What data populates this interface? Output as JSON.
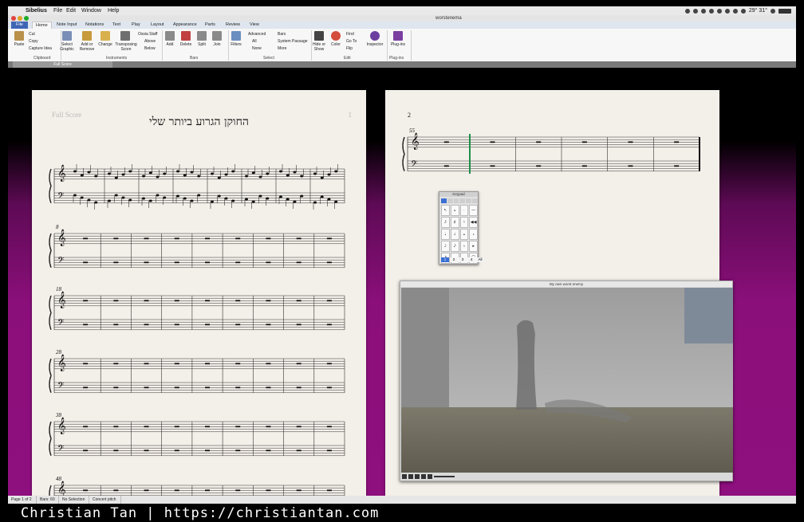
{
  "menubar": {
    "app": "Sibelius",
    "items": [
      "File",
      "Edit",
      "Window",
      "Help"
    ],
    "clock": "29° 31°"
  },
  "window": {
    "doc_title": "worstenema"
  },
  "ribbon": {
    "tabs": [
      "File",
      "Home",
      "Note Input",
      "Notations",
      "Text",
      "Play",
      "Layout",
      "Appearance",
      "Parts",
      "Review",
      "View"
    ],
    "clipboard": {
      "paste": "Paste",
      "cut": "Cut",
      "copy": "Copy",
      "capture": "Capture Idea",
      "label": "Clipboard"
    },
    "instruments": {
      "select_graphic": "Select Graphic",
      "add_remove": "Add or Remove",
      "change": "Change",
      "transposing": "Transposing Score",
      "ossia": "Ossia Staff",
      "above": "Above",
      "below": "Below",
      "label": "Instruments"
    },
    "bars": {
      "add": "Add",
      "delete": "Delete",
      "split": "Split",
      "join": "Join",
      "label": "Bars"
    },
    "select": {
      "filters": "Filters",
      "advanced": "Advanced",
      "all": "All",
      "none": "None",
      "bars": "Bars",
      "system_passage": "System Passage",
      "more": "More",
      "label": "Select"
    },
    "edit": {
      "hide_show": "Hide or Show",
      "color": "Color",
      "find": "Find",
      "goto": "Go To",
      "flip": "Flip",
      "inspector": "Inspector",
      "label": "Edit"
    },
    "plugins": {
      "plugins": "Plug-ins",
      "label": "Plug-ins"
    }
  },
  "viewbar": {
    "tab": "Full Score"
  },
  "page1": {
    "label": "Full Score",
    "page_number": "1",
    "title": "החוקן הגרוע ביותר שלי",
    "system_numbers": [
      "8",
      "18",
      "28",
      "38",
      "48"
    ]
  },
  "page2": {
    "page_number": "2",
    "system_numbers": [
      "55"
    ]
  },
  "keypad": {
    "title": "Keypad",
    "layouts": [
      "1",
      "2",
      "3",
      "4",
      "All"
    ],
    "keys": [
      "↖",
      "𝄪",
      "·",
      "—",
      "𝅘𝅥𝅯",
      "♯",
      "♮",
      "◀◀",
      "𝅘𝅥",
      "𝅗𝅥",
      "𝅝",
      "𝅗",
      "𝅘𝅥𝅮",
      "𝅘𝅥𝅯",
      "♭",
      "▸",
      "𝅘𝅥𝅰",
      "·",
      "",
      "⌒"
    ],
    "accent": "#3b6fd4"
  },
  "video": {
    "title": "My own worst enemy"
  },
  "statusbar": [
    "Page 1 of 2",
    "Bars: 60",
    "No Selection",
    "Concert pitch"
  ],
  "caption": "Christian Tan | https://christiantan.com",
  "colors": {
    "background_magenta": "#8b0f7b",
    "file_tab": "#3f66b5",
    "playline": "#1e8f4a"
  }
}
